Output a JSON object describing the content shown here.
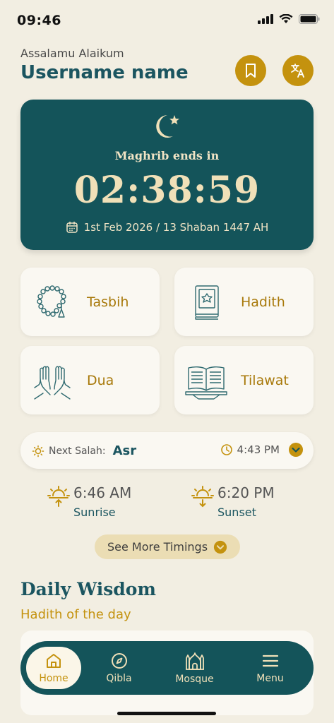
{
  "status_bar": {
    "time": "09:46"
  },
  "header": {
    "greeting": "Assalamu Alaikum",
    "username": "Username name",
    "bookmark_icon": "bookmark-icon",
    "translate_icon": "translate-icon"
  },
  "hero": {
    "label": "Maghrib ends in",
    "countdown": "02:38:59",
    "date": "1st Feb 2026 / 13 Shaban 1447 AH"
  },
  "features": [
    {
      "label": "Tasbih",
      "icon": "tasbih-icon"
    },
    {
      "label": "Hadith",
      "icon": "hadith-book-icon"
    },
    {
      "label": "Dua",
      "icon": "dua-hands-icon"
    },
    {
      "label": "Tilawat",
      "icon": "quran-stand-icon"
    }
  ],
  "salah": {
    "prefix": "Next Salah:",
    "name": "Asr",
    "time": "4:43 PM"
  },
  "sun": {
    "sunrise_time": "6:46 AM",
    "sunrise_label": "Sunrise",
    "sunset_time": "6:20 PM",
    "sunset_label": "Sunset"
  },
  "more_timings": "See More Timings",
  "wisdom": {
    "title": "Daily Wisdom",
    "subtitle": "Hadith of the day"
  },
  "nav": [
    {
      "label": "Home",
      "icon": "home-icon",
      "active": true
    },
    {
      "label": "Qibla",
      "icon": "compass-icon",
      "active": false
    },
    {
      "label": "Mosque",
      "icon": "mosque-icon",
      "active": false
    },
    {
      "label": "Menu",
      "icon": "menu-icon",
      "active": false
    }
  ],
  "colors": {
    "primary": "#14545A",
    "accent": "#C4920E",
    "background": "#F2EEE2",
    "card": "#FAF8F2"
  }
}
